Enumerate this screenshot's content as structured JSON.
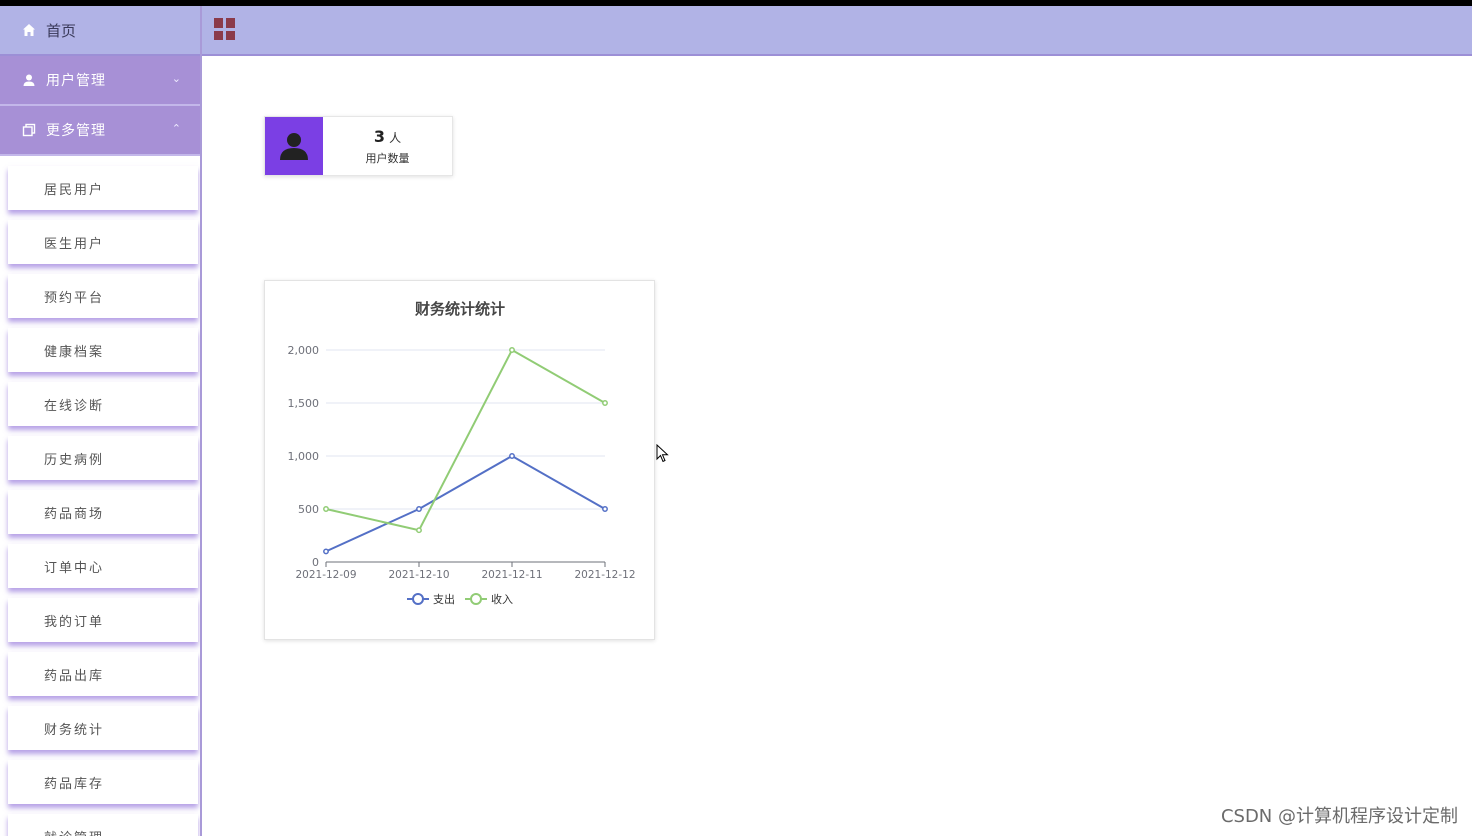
{
  "sidebar": {
    "home_label": "首页",
    "groups": [
      {
        "label": "用户管理",
        "chevron": "⌄",
        "icon": "user-icon"
      },
      {
        "label": "更多管理",
        "chevron": "⌃",
        "icon": "copy-icon"
      }
    ],
    "items": [
      "居民用户",
      "医生用户",
      "预约平台",
      "健康档案",
      "在线诊断",
      "历史病例",
      "药品商场",
      "订单中心",
      "我的订单",
      "药品出库",
      "财务统计",
      "药品库存",
      "就诊管理"
    ]
  },
  "header": {
    "icon": "grid-icon"
  },
  "stat_card": {
    "value": "3",
    "unit": "人",
    "label": "用户数量",
    "icon": "person-icon",
    "accent": "#7b3fe4"
  },
  "chart_data": {
    "type": "line",
    "title": "财务统计统计",
    "x": [
      "2021-12-09",
      "2021-12-10",
      "2021-12-11",
      "2021-12-12"
    ],
    "ylim": [
      0,
      2000
    ],
    "yticks": [
      "0",
      "500",
      "1,000",
      "1,500",
      "2,000"
    ],
    "grid": true,
    "legend": "bottom",
    "series": [
      {
        "name": "支出",
        "values": [
          100,
          500,
          1000,
          500
        ],
        "color": "#5470c6"
      },
      {
        "name": "收入",
        "values": [
          500,
          300,
          2000,
          1500
        ],
        "color": "#91cc75"
      }
    ]
  },
  "watermark": "CSDN @计算机程序设计定制"
}
